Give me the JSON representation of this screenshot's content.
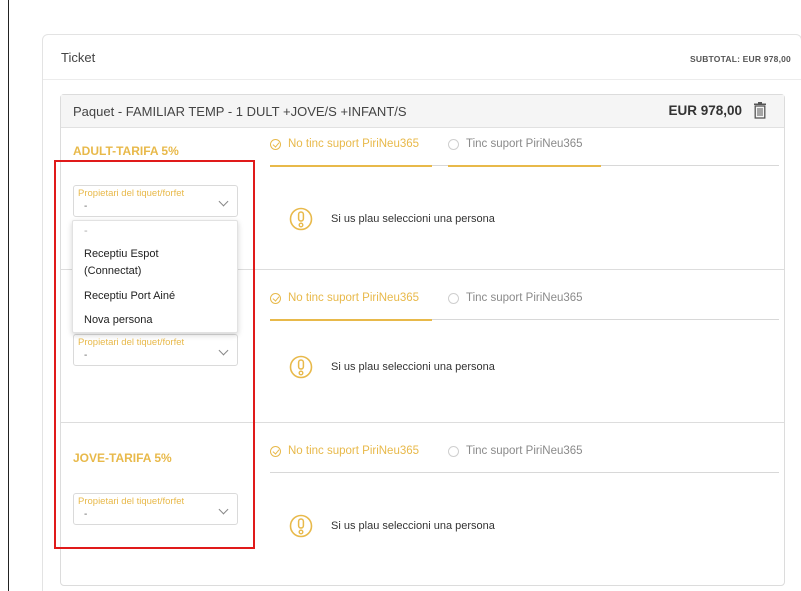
{
  "ticket": {
    "title": "Ticket",
    "subtotal": "SUBTOTAL: EUR 978,00"
  },
  "package": {
    "title": "Paquet - FAMILIAR TEMP - 1 DULT +JOVE/S +INFANT/S",
    "price": "EUR 978,00",
    "delete_icon": "trash-icon"
  },
  "sections": [
    {
      "label": "ADULT-TARIFA 5%",
      "tab_no_support": "No tinc suport PiriNeu365",
      "tab_support": "Tinc suport PiriNeu365",
      "select_label": "Propietari del tiquet/forfet",
      "select_value": "-",
      "warning": "Si us plau seleccioni una persona"
    },
    {
      "label": "",
      "tab_no_support": "No tinc suport PiriNeu365",
      "tab_support": "Tinc suport PiriNeu365",
      "select_label": "Propietari del tiquet/forfet",
      "select_value": "-",
      "warning": "Si us plau seleccioni una persona"
    },
    {
      "label": "JOVE-TARIFA 5%",
      "tab_no_support": "No tinc suport PiriNeu365",
      "tab_support": "Tinc suport PiriNeu365",
      "select_label": "Propietari del tiquet/forfet",
      "select_value": "-",
      "warning": "Si us plau seleccioni una persona"
    }
  ],
  "dropdown": {
    "options": [
      "-",
      "Receptiu Espot (Connectat)",
      "Receptiu Port Ainé",
      "Nova persona"
    ]
  },
  "colors": {
    "accent": "#e8b94a",
    "highlight": "#e01a1a"
  }
}
